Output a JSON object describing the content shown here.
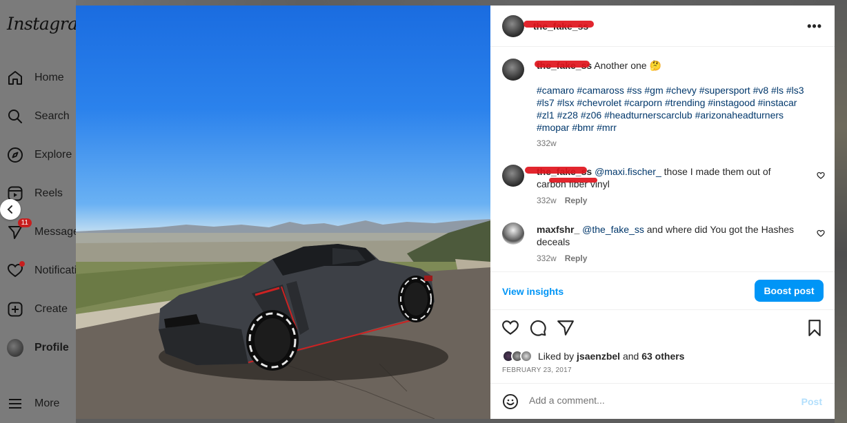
{
  "sidebar": {
    "logo": "Instagram",
    "items": [
      {
        "label": "Home",
        "icon": "home-icon"
      },
      {
        "label": "Search",
        "icon": "search-icon"
      },
      {
        "label": "Explore",
        "icon": "compass-icon"
      },
      {
        "label": "Reels",
        "icon": "reels-icon"
      },
      {
        "label": "Messages",
        "icon": "messenger-icon",
        "badge": "11"
      },
      {
        "label": "Notifications",
        "icon": "heart-icon"
      },
      {
        "label": "Create",
        "icon": "plus-square-icon"
      },
      {
        "label": "Profile",
        "icon": "avatar"
      },
      {
        "label": "More",
        "icon": "menu-icon"
      }
    ]
  },
  "post": {
    "author": "the_fake_ss",
    "caption": {
      "author": "the_fake_ss",
      "text": "Another one 🤔",
      "hashtags": "#camaro #camaross #ss #gm #chevy #supersport #v8 #ls #ls3 #ls7 #lsx #chevrolet #carporn #trending #instagood #instacar #zl1 #z28 #z06 #headturnerscarclub #arizonaheadturners #mopar #bmr #mrr",
      "time": "332w"
    },
    "comments": [
      {
        "author": "the_fake_ss",
        "mention": "@maxi.fischer_",
        "text": " those I made them out of carbon fiber vinyl",
        "time": "332w",
        "reply": "Reply"
      },
      {
        "author": "maxfshr_",
        "mention": "@the_fake_ss",
        "text": " and where did You got the Hashes deceals",
        "time": "332w",
        "reply": "Reply"
      }
    ],
    "insights_label": "View insights",
    "boost_label": "Boost post",
    "likes": {
      "prefix": "Liked by",
      "user": "jsaenzbel",
      "and": "and",
      "others": "63 others"
    },
    "date": "FEBRUARY 23, 2017",
    "add_comment_placeholder": "Add a comment...",
    "post_label": "Post",
    "more_options": "•••"
  },
  "colors": {
    "accent": "#0095f6",
    "link": "#00376b",
    "redaction": "#e0141c"
  }
}
